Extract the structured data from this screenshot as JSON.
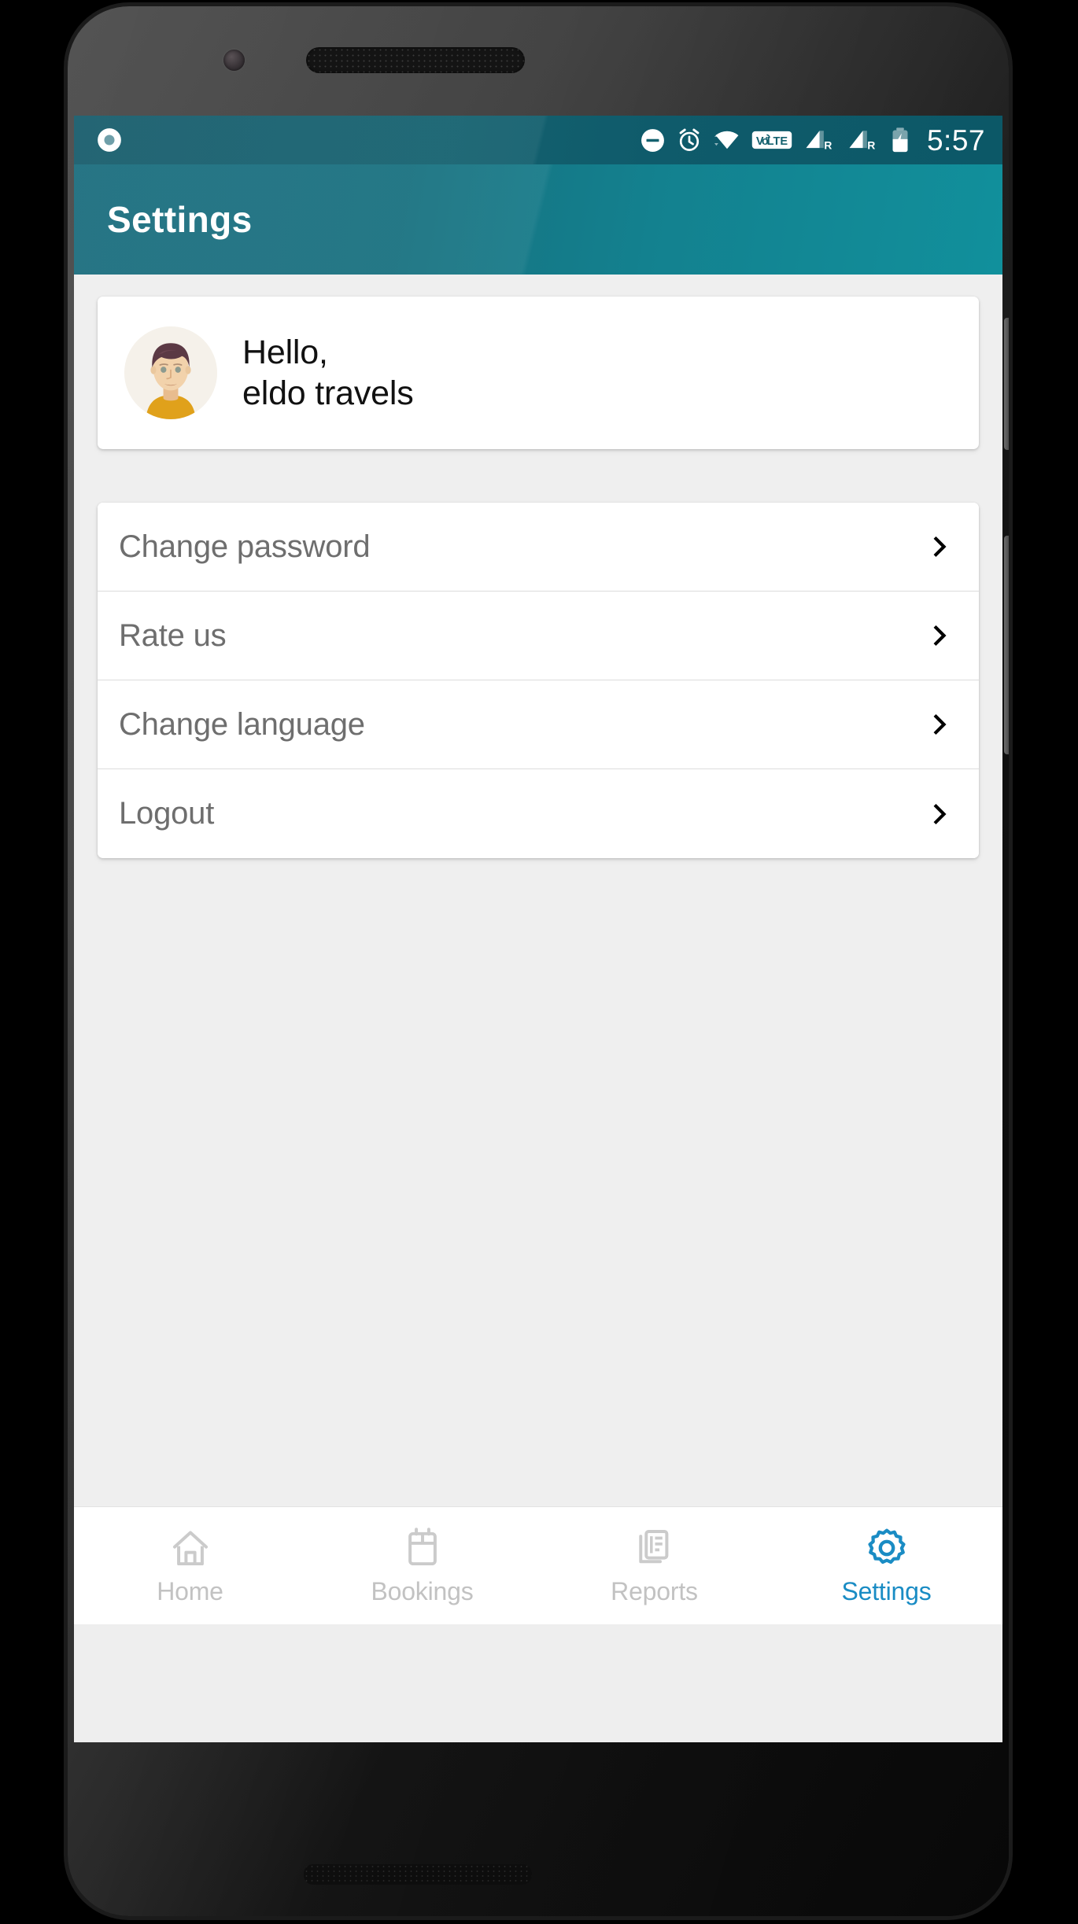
{
  "device": {
    "frame_name": "android-phone",
    "hardware": {
      "front_camera": "front-camera",
      "earpiece": "earpiece-speaker",
      "bottom_speaker": "bottom-speaker",
      "power_button": "power-button",
      "volume_rocker": "volume-rocker"
    }
  },
  "status_bar": {
    "background_color": "#14616f",
    "text_color": "#ffffff",
    "clock": "5:57",
    "left_icons": [
      {
        "name": "notification-dot-icon",
        "label": "notification"
      }
    ],
    "right_icons": [
      {
        "name": "do-not-disturb-icon",
        "label": "Do not disturb"
      },
      {
        "name": "alarm-clock-icon",
        "label": "Alarm set"
      },
      {
        "name": "wifi-icon",
        "label": "Wi-Fi connected"
      },
      {
        "name": "volte-icon",
        "label": "VoLTE"
      },
      {
        "name": "signal-sim1-icon",
        "label": "Signal SIM 1 roaming",
        "badge": "R"
      },
      {
        "name": "signal-sim2-icon",
        "label": "Signal SIM 2 roaming",
        "badge": "R"
      },
      {
        "name": "battery-charging-icon",
        "label": "Battery charging"
      }
    ]
  },
  "app_bar": {
    "title": "Settings",
    "gradient_start": "#1a6c7d",
    "gradient_end": "#11909c",
    "title_color": "#ffffff"
  },
  "profile_card": {
    "greeting": "Hello,",
    "user_name": "eldo travels",
    "avatar": {
      "name": "user-avatar",
      "hair_color": "#5b3944",
      "skin_color": "#f0cfa8",
      "shirt_color": "#e0a11b",
      "background_color": "#f5f1ea"
    }
  },
  "menu": {
    "items": [
      {
        "label": "Change password",
        "name": "menu-item-change-password",
        "chevron": "chevron-right-icon"
      },
      {
        "label": "Rate us",
        "name": "menu-item-rate-us",
        "chevron": "chevron-right-icon"
      },
      {
        "label": "Change language",
        "name": "menu-item-change-language",
        "chevron": "chevron-right-icon"
      },
      {
        "label": "Logout",
        "name": "menu-item-logout",
        "chevron": "chevron-right-icon"
      }
    ],
    "label_color": "#6e6e6e",
    "divider_color": "#dcdcdc"
  },
  "bottom_nav": {
    "active_color": "#1a8cc4",
    "inactive_color": "#c2c2c2",
    "items": [
      {
        "label": "Home",
        "icon": "home-icon",
        "active": false
      },
      {
        "label": "Bookings",
        "icon": "calendar-icon",
        "active": false
      },
      {
        "label": "Reports",
        "icon": "report-document-icon",
        "active": false
      },
      {
        "label": "Settings",
        "icon": "gear-icon",
        "active": true
      }
    ]
  }
}
